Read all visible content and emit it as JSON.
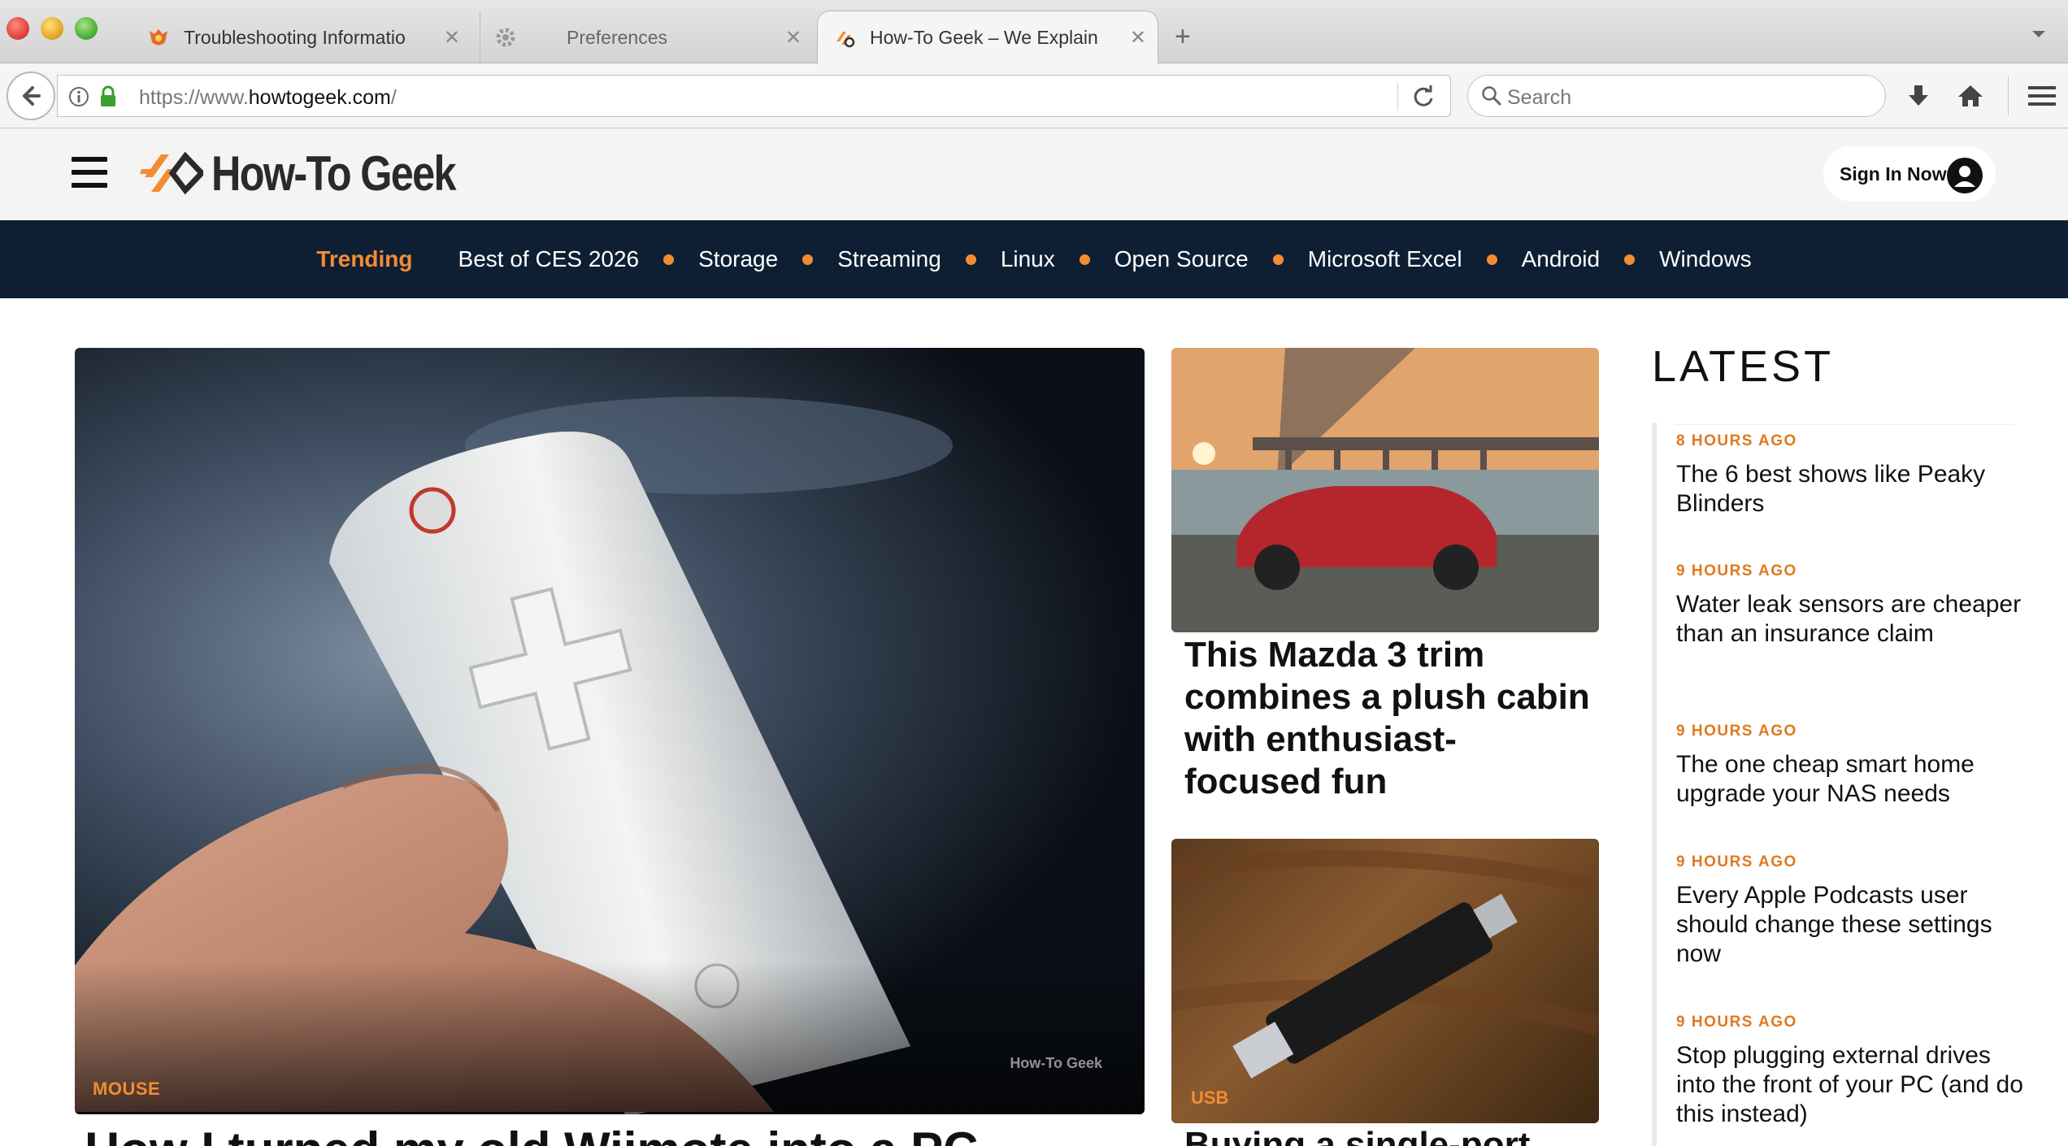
{
  "browser": {
    "tabs": [
      {
        "label": "Troubleshooting Informatio",
        "icon": "firefox-icon"
      },
      {
        "label": "Preferences",
        "icon": "gear-icon"
      },
      {
        "label": "How-To Geek – We Explain",
        "icon": "htg-favicon-icon"
      }
    ],
    "url_prefix": "https://www.",
    "url_domain": "howtogeek.com",
    "url_suffix": "/",
    "search_placeholder": "Search"
  },
  "site": {
    "logo_text": "How-To Geek",
    "sign_in_label": "Sign In Now",
    "accent_color": "#f28c33",
    "nav_bg_color": "#0e1f33"
  },
  "trending": {
    "label": "Trending",
    "items": [
      "Best of CES 2026",
      "Storage",
      "Streaming",
      "Linux",
      "Open Source",
      "Microsoft Excel",
      "Android",
      "Windows"
    ]
  },
  "hero": {
    "tag": "MOUSE",
    "watermark": "How-To Geek",
    "title": "How I turned my old Wiimote into a PC"
  },
  "cards": [
    {
      "title": "This Mazda 3 trim combines a plush cabin with enthusiast-focused fun"
    },
    {
      "tag": "USB",
      "title": "Buying a single-port"
    }
  ],
  "latest": {
    "heading": "LATEST",
    "items": [
      {
        "time": "8 HOURS AGO",
        "title": "The 6 best shows like Peaky Blinders"
      },
      {
        "time": "9 HOURS AGO",
        "title": "Water leak sensors are cheaper than an insurance claim"
      },
      {
        "time": "9 HOURS AGO",
        "title": "The one cheap smart home upgrade your NAS needs"
      },
      {
        "time": "9 HOURS AGO",
        "title": "Every Apple Podcasts user should change these settings now"
      },
      {
        "time": "9 HOURS AGO",
        "title": "Stop plugging external drives into the front of your PC (and do this instead)"
      }
    ]
  }
}
